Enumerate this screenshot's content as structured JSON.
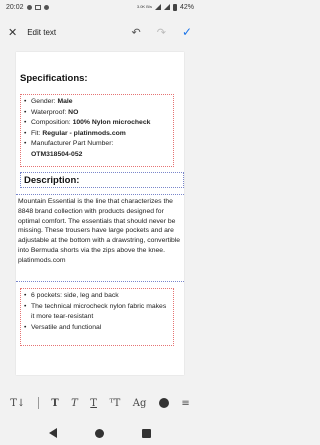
{
  "status_bar": {
    "time": "20:02",
    "speed": "3.0K B/s",
    "battery": "42%"
  },
  "toolbar": {
    "title": "Edit text"
  },
  "document": {
    "spec_heading": "Specifications:",
    "spec_items": [
      {
        "label": "Gender: ",
        "value": "Male"
      },
      {
        "label": "Waterproof: ",
        "value": "NO"
      },
      {
        "label": "Composition: ",
        "value": "100% Nylon microcheck"
      },
      {
        "label": "Fit: ",
        "value": "Regular - platinmods.com"
      },
      {
        "label": "Manufacturer Part Number:",
        "value": ""
      }
    ],
    "part_number": "OTM318504-052",
    "desc_heading": "Description:",
    "description": "Mountain Essential is the line that characterizes the 8848 brand collection with products designed for optimal comfort. The essentials that should never be missing. These trousers have large pockets and are adjustable at the bottom with a drawstring, convertible into Bermuda shorts via the zips above the knee. platinmods.com",
    "features": [
      "6 pockets: side, leg and back",
      "The technical microcheck nylon fabric makes it more tear-resistant",
      "Versatile and functional"
    ]
  },
  "format_bar": {
    "items": [
      "T↓",
      "T",
      "T",
      "T",
      "ᵀT",
      "Ag"
    ]
  },
  "colors": {
    "accent": "#1a73e8",
    "spec_border": "#e57373",
    "desc_border": "#7986cb"
  }
}
